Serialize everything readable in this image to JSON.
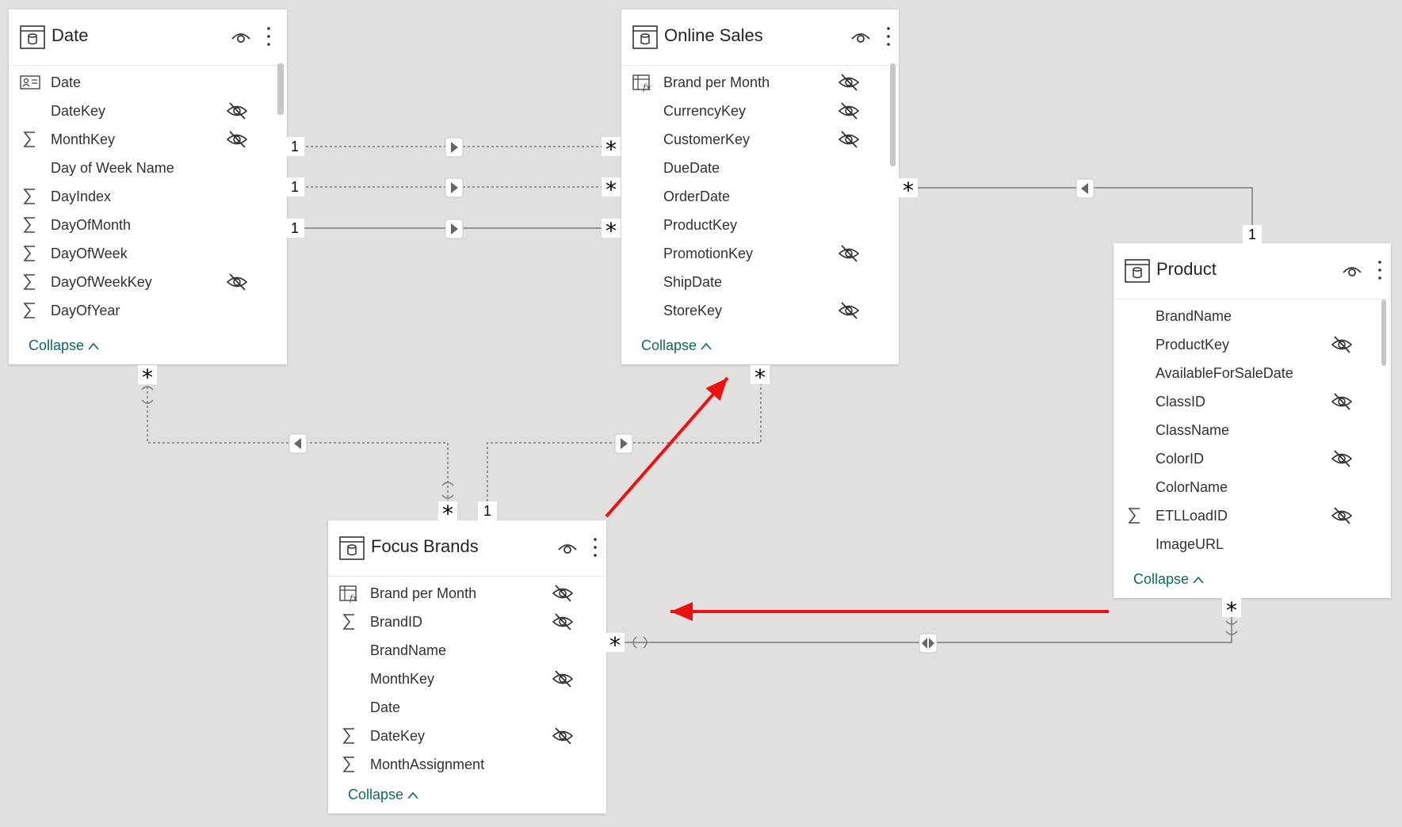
{
  "tables": {
    "date": {
      "title": "Date",
      "fields": [
        "Date",
        "DateKey",
        "MonthKey",
        "Day of Week Name",
        "DayIndex",
        "DayOfMonth",
        "DayOfWeek",
        "DayOfWeekKey",
        "DayOfYear"
      ],
      "field_icons": [
        "key-card-icon",
        "none",
        "sigma-icon",
        "none",
        "sigma-icon",
        "sigma-icon",
        "sigma-icon",
        "sigma-icon",
        "sigma-icon"
      ],
      "hidden": [
        false,
        true,
        true,
        false,
        false,
        false,
        false,
        true,
        false
      ],
      "collapse_label": "Collapse"
    },
    "online_sales": {
      "title": "Online Sales",
      "fields": [
        "Brand per Month",
        "CurrencyKey",
        "CustomerKey",
        "DueDate",
        "OrderDate",
        "ProductKey",
        "PromotionKey",
        "ShipDate",
        "StoreKey"
      ],
      "field_icons": [
        "calc-table-icon",
        "none",
        "none",
        "none",
        "none",
        "none",
        "none",
        "none",
        "none"
      ],
      "hidden": [
        true,
        true,
        true,
        false,
        false,
        false,
        true,
        false,
        true
      ],
      "collapse_label": "Collapse"
    },
    "product": {
      "title": "Product",
      "fields": [
        "BrandName",
        "ProductKey",
        "AvailableForSaleDate",
        "ClassID",
        "ClassName",
        "ColorID",
        "ColorName",
        "ETLLoadID",
        "ImageURL"
      ],
      "field_icons": [
        "none",
        "none",
        "none",
        "none",
        "none",
        "none",
        "none",
        "sigma-icon",
        "none"
      ],
      "hidden": [
        false,
        true,
        false,
        true,
        false,
        true,
        false,
        true,
        false
      ],
      "collapse_label": "Collapse"
    },
    "focus_brands": {
      "title": "Focus Brands",
      "fields": [
        "Brand per Month",
        "BrandID",
        "BrandName",
        "MonthKey",
        "Date",
        "DateKey",
        "MonthAssignment"
      ],
      "field_icons": [
        "calc-table-icon",
        "sigma-icon",
        "none",
        "none",
        "none",
        "sigma-icon",
        "sigma-icon"
      ],
      "hidden": [
        true,
        true,
        false,
        true,
        false,
        true,
        false
      ],
      "collapse_label": "Collapse"
    }
  },
  "relationship_markers": {
    "one": "1",
    "many": "*"
  },
  "colors": {
    "canvas": "#e1e0df",
    "card": "#ffffff",
    "relationship_line": "#7a7a7a",
    "collapse_link": "#0b6a5c",
    "annotation_arrow": "#ee1111"
  }
}
